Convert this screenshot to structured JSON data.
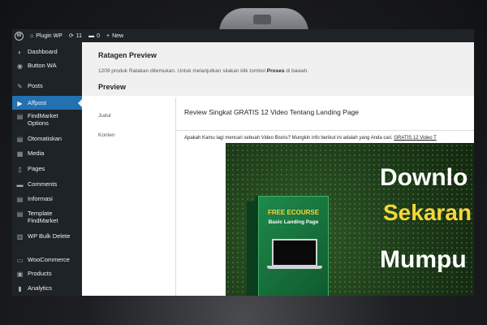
{
  "admin_bar": {
    "site_name": "Plugin WP",
    "updates_count": "11",
    "comments_count": "0",
    "new_label": "New"
  },
  "sidebar": {
    "items": [
      {
        "label": "Dashboard",
        "icon": "dashboard-icon"
      },
      {
        "label": "Button WA",
        "icon": "whatsapp-icon"
      },
      {
        "label": "Posts",
        "icon": "pin-icon"
      },
      {
        "label": "Affpost",
        "icon": "play-icon",
        "active": true
      },
      {
        "label": "FindMarket Options",
        "icon": "document-icon"
      },
      {
        "label": "Otomatiskan",
        "icon": "document-icon"
      },
      {
        "label": "Media",
        "icon": "media-icon"
      },
      {
        "label": "Pages",
        "icon": "page-icon"
      },
      {
        "label": "Comments",
        "icon": "comment-icon"
      },
      {
        "label": "Informasi",
        "icon": "document-icon"
      },
      {
        "label": "Template FindMarket",
        "icon": "document-icon"
      },
      {
        "label": "WP Bulk Delete",
        "icon": "trash-icon"
      },
      {
        "label": "WooCommerce",
        "icon": "woocommerce-icon"
      },
      {
        "label": "Products",
        "icon": "products-icon"
      },
      {
        "label": "Analytics",
        "icon": "analytics-icon"
      }
    ]
  },
  "main": {
    "page_title": "Ratagen Preview",
    "notice_before": "1209 produk Ratakan ditemukan. Untuk melanjutkan silakan klik tombol ",
    "notice_bold": "Proses",
    "notice_after": " di bawah.",
    "section_title": "Preview",
    "label_judul": "Judul",
    "label_konten": "Konten",
    "post_title": "Review Singkat GRATIS 12 Video Tentang Landing Page",
    "intro_text": "Apakah Kamu lagi mencari sebuah Video Bisnis? Mungkin info berikut ini adalah yang Anda cari. ",
    "intro_link": "GRATIS 12 Video T",
    "banner": {
      "box_line1": "FREE ECOURSE",
      "box_line2": "Basic Landing Page",
      "headline1": "Downlo",
      "headline2": "Sekaran",
      "headline3": "Mumpu"
    }
  },
  "colors": {
    "admin_dark": "#1d2327",
    "accent_blue": "#2271b1",
    "banner_green": "#1d3b19",
    "headline_yellow": "#f4d73b"
  }
}
